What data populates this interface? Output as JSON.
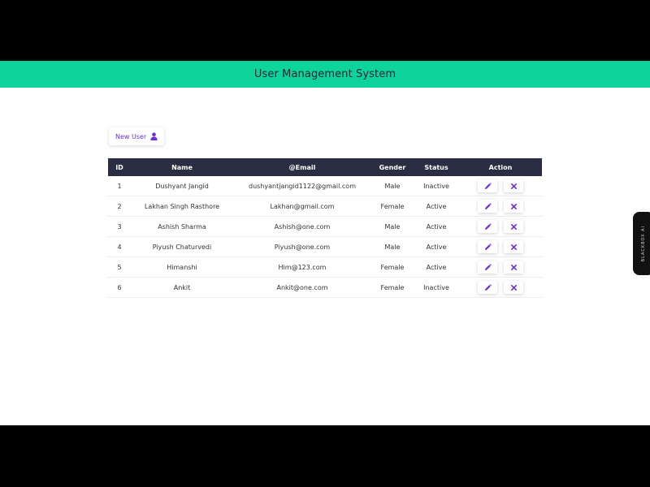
{
  "header": {
    "title": "User Management System"
  },
  "toolbar": {
    "new_user_label": "New User"
  },
  "table": {
    "headers": {
      "id": "ID",
      "name": "Name",
      "email": "@Email",
      "gender": "Gender",
      "status": "Status",
      "action": "Action"
    },
    "rows": [
      {
        "id": "1",
        "name": "Dushyant Jangid",
        "email": "dushyantjangid1122@gmail.com",
        "gender": "Male",
        "status": "Inactive"
      },
      {
        "id": "2",
        "name": "Lakhan Singh Rasthore",
        "email": "Lakhan@gmail.com",
        "gender": "Female",
        "status": "Active"
      },
      {
        "id": "3",
        "name": "Ashish Sharma",
        "email": "Ashish@one.com",
        "gender": "Male",
        "status": "Active"
      },
      {
        "id": "4",
        "name": "Piyush Chaturvedi",
        "email": "Piyush@one.com",
        "gender": "Male",
        "status": "Active"
      },
      {
        "id": "5",
        "name": "Himanshi",
        "email": "Him@123.com",
        "gender": "Female",
        "status": "Active"
      },
      {
        "id": "6",
        "name": "Ankit",
        "email": "Ankit@one.com",
        "gender": "Female",
        "status": "Inactive"
      }
    ]
  },
  "side_widget": {
    "label": "BLACKBOX AI"
  },
  "icons": {
    "new_user": "user-icon",
    "edit": "pencil-icon",
    "delete": "close-icon"
  },
  "colors": {
    "header_bg": "#0fd39c",
    "table_header_bg": "#2b2d42",
    "accent": "#6d2ee0"
  }
}
